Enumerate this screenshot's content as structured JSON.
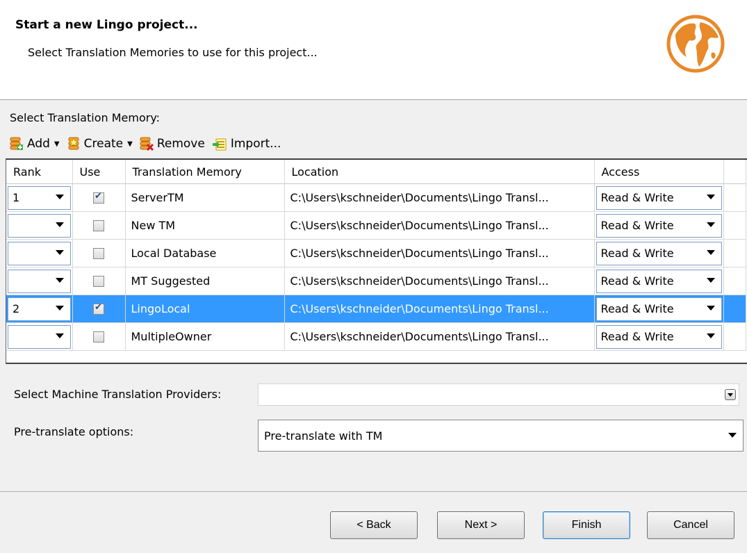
{
  "header": {
    "title": "Start a new Lingo project...",
    "subtitle": "Select Translation Memories to use for this project..."
  },
  "tm_section": {
    "label": "Select Translation Memory:",
    "toolbar": [
      {
        "label": "Add",
        "icon": "db-add-icon",
        "dropdown": true
      },
      {
        "label": "Create",
        "icon": "db-create-icon",
        "dropdown": true
      },
      {
        "label": "Remove",
        "icon": "db-remove-icon",
        "dropdown": false
      },
      {
        "label": "Import...",
        "icon": "import-icon",
        "dropdown": false
      }
    ]
  },
  "grid": {
    "columns": [
      "Rank",
      "Use",
      "Translation Memory",
      "Location",
      "Access"
    ],
    "rows": [
      {
        "rank": "1",
        "use": true,
        "name": "ServerTM",
        "location": "C:\\Users\\kschneider\\Documents\\Lingo Transl...",
        "access": "Read & Write",
        "selected": false
      },
      {
        "rank": "",
        "use": false,
        "name": "New TM",
        "location": "C:\\Users\\kschneider\\Documents\\Lingo Transl...",
        "access": "Read & Write",
        "selected": false
      },
      {
        "rank": "",
        "use": false,
        "name": "Local Database",
        "location": "C:\\Users\\kschneider\\Documents\\Lingo Transl...",
        "access": "Read & Write",
        "selected": false
      },
      {
        "rank": "",
        "use": false,
        "name": "MT Suggested",
        "location": "C:\\Users\\kschneider\\Documents\\Lingo Transl...",
        "access": "Read & Write",
        "selected": false
      },
      {
        "rank": "2",
        "use": true,
        "name": "LingoLocal",
        "location": "C:\\Users\\kschneider\\Documents\\Lingo Transl...",
        "access": "Read & Write",
        "selected": true
      },
      {
        "rank": "",
        "use": false,
        "name": "MultipleOwner",
        "location": "C:\\Users\\kschneider\\Documents\\Lingo Transl...",
        "access": "Read & Write",
        "selected": false
      }
    ]
  },
  "mt": {
    "label": "Select Machine Translation Providers:",
    "value": ""
  },
  "pretranslate": {
    "label": "Pre-translate options:",
    "value": "Pre-translate with TM"
  },
  "buttons": {
    "back": "< Back",
    "next": "Next >",
    "finish": "Finish",
    "cancel": "Cancel"
  },
  "colors": {
    "selection": "#3399ff",
    "globe": "#e8892a"
  }
}
